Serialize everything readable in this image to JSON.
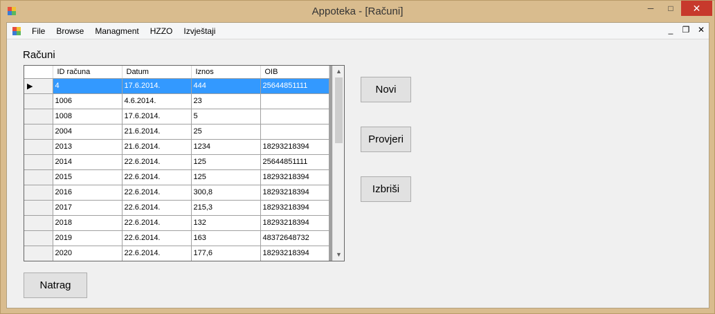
{
  "window": {
    "title": "Appoteka - [Računi]",
    "minimize": "─",
    "maximize": "□",
    "close": "✕"
  },
  "menu": {
    "items": [
      "File",
      "Browse",
      "Managment",
      "HZZO",
      "Izvještaji"
    ],
    "mdi_minimize": "_",
    "mdi_restore": "❐",
    "mdi_close": "✕"
  },
  "section_title": "Računi",
  "grid": {
    "columns": [
      "ID računa",
      "Datum",
      "Iznos",
      "OIB"
    ],
    "selected_row_marker": "▶",
    "rows": [
      [
        "4",
        "17.6.2014.",
        "444",
        "25644851111"
      ],
      [
        "1006",
        "4.6.2014.",
        "23",
        ""
      ],
      [
        "1008",
        "17.6.2014.",
        "5",
        ""
      ],
      [
        "2004",
        "21.6.2014.",
        "25",
        ""
      ],
      [
        "2013",
        "21.6.2014.",
        "1234",
        "18293218394"
      ],
      [
        "2014",
        "22.6.2014.",
        "125",
        "25644851111"
      ],
      [
        "2015",
        "22.6.2014.",
        "125",
        "18293218394"
      ],
      [
        "2016",
        "22.6.2014.",
        "300,8",
        "18293218394"
      ],
      [
        "2017",
        "22.6.2014.",
        "215,3",
        "18293218394"
      ],
      [
        "2018",
        "22.6.2014.",
        "132",
        "18293218394"
      ],
      [
        "2019",
        "22.6.2014.",
        "163",
        "48372648732"
      ],
      [
        "2020",
        "22.6.2014.",
        "177,6",
        "18293218394"
      ]
    ],
    "scroll_up": "▲",
    "scroll_down": "▼"
  },
  "buttons": {
    "novi": "Novi",
    "provjeri": "Provjeri",
    "izbrisi": "Izbriši",
    "natrag": "Natrag"
  },
  "colors": {
    "frame": "#d9bc8e",
    "selection": "#3399ff",
    "close_button": "#c7392c"
  }
}
